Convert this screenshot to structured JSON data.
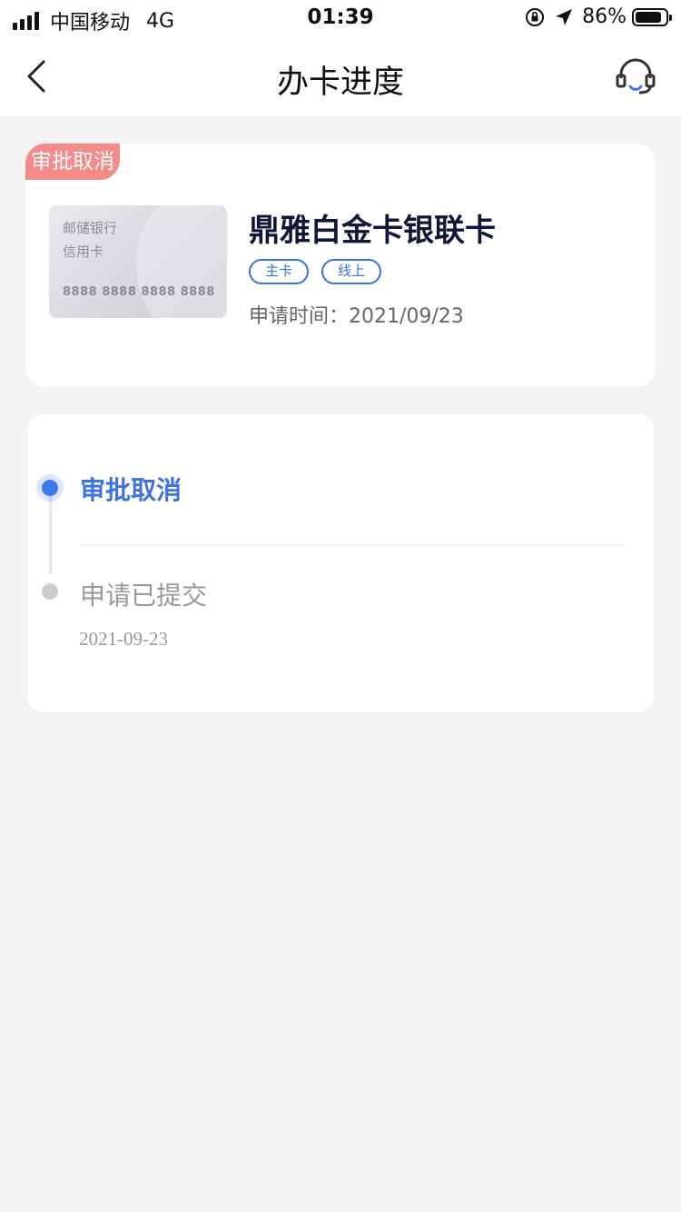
{
  "status_bar": {
    "carrier": "中国移动",
    "network": "4G",
    "time": "01:39",
    "battery_pct": "86%",
    "battery_level": 0.86,
    "icons": [
      "signal-icon",
      "rotation-lock-icon",
      "location-icon",
      "battery-icon"
    ]
  },
  "nav": {
    "title": "办卡进度",
    "back_icon": "chevron-left-icon",
    "service_icon": "headset-icon"
  },
  "product": {
    "status_label": "审批取消",
    "status_color": "#f48b86",
    "card_image": {
      "bank": "邮储银行",
      "type": "信用卡",
      "number": "8888 8888 8888 8888"
    },
    "name": "鼎雅白金卡银联卡",
    "tags": [
      "主卡",
      "线上"
    ],
    "apply_time": "申请时间：2021/09/23"
  },
  "progress": {
    "accent_color": "#3d72df",
    "steps": [
      {
        "title": "审批取消",
        "date": "",
        "active": true
      },
      {
        "title": "申请已提交",
        "date": "2021-09-23",
        "active": false
      }
    ]
  }
}
